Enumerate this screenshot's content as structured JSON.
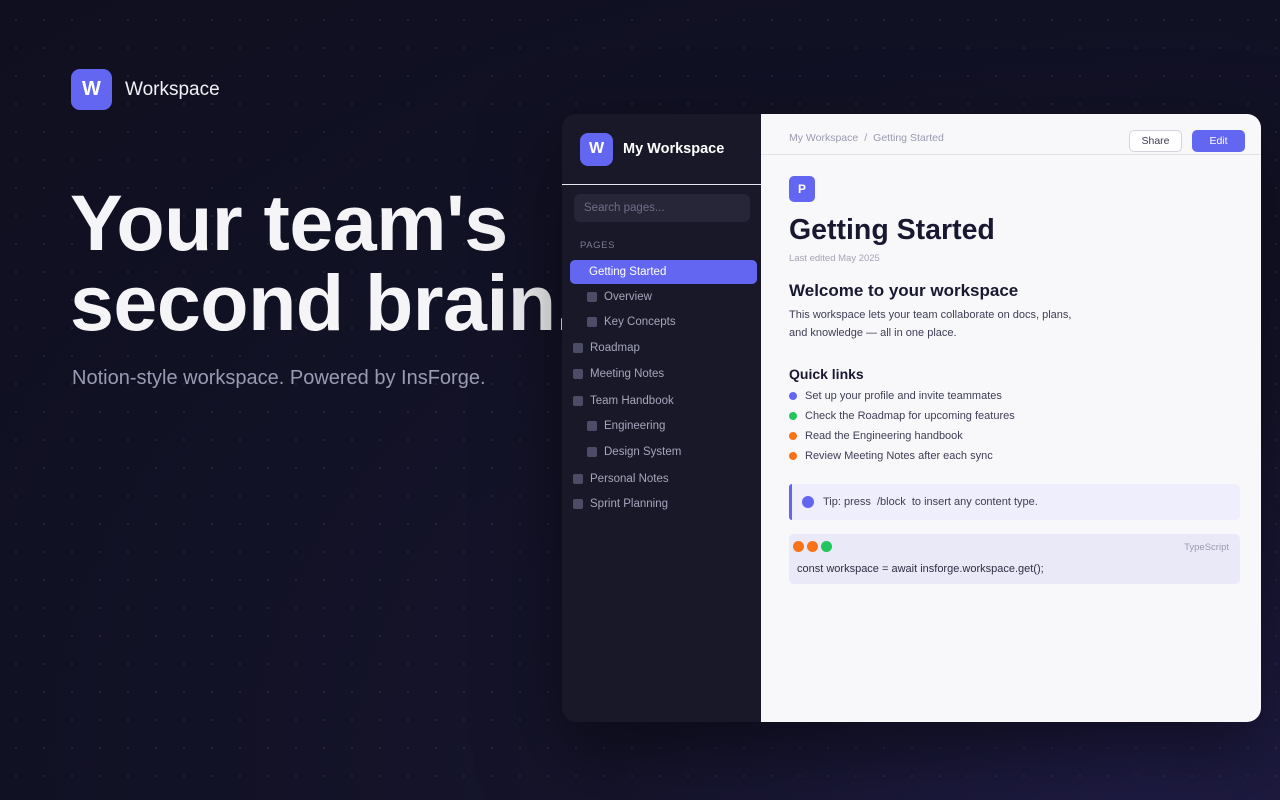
{
  "brand": {
    "logo_letter": "W",
    "name": "Workspace"
  },
  "hero": {
    "title_line1": "Your team's",
    "title_line2": "second brain.",
    "subtitle": "Notion-style workspace. Powered by InsForge."
  },
  "sidebar": {
    "logo_letter": "W",
    "title": "My Workspace",
    "search_placeholder": "Search pages...",
    "section_label": "PAGES",
    "items": [
      {
        "label": "Getting Started",
        "level": 0,
        "active": true
      },
      {
        "label": "Overview",
        "level": 1,
        "active": false
      },
      {
        "label": "Key Concepts",
        "level": 1,
        "active": false
      },
      {
        "label": "Roadmap",
        "level": 0,
        "active": false
      },
      {
        "label": "Meeting Notes",
        "level": 0,
        "active": false
      },
      {
        "label": "Team Handbook",
        "level": 0,
        "active": false
      },
      {
        "label": "Engineering",
        "level": 1,
        "active": false
      },
      {
        "label": "Design System",
        "level": 1,
        "active": false
      },
      {
        "label": "Personal Notes",
        "level": 0,
        "active": false
      },
      {
        "label": "Sprint Planning",
        "level": 0,
        "active": false
      }
    ]
  },
  "topbar": {
    "breadcrumb_root": "My Workspace",
    "breadcrumb_sep": "/",
    "breadcrumb_current": "Getting Started",
    "share_label": "Share",
    "edit_label": "Edit"
  },
  "page": {
    "icon_letter": "P",
    "title": "Getting Started",
    "meta": "Last edited May 2025",
    "welcome_heading": "Welcome to your workspace",
    "welcome_line1": "This workspace lets your team collaborate on docs, plans,",
    "welcome_line2": "and knowledge — all in one place.",
    "quick_links_heading": "Quick links",
    "quick_links": [
      {
        "text": "Set up your profile and invite teammates",
        "color": "#6366f1"
      },
      {
        "text": "Check the Roadmap for upcoming features",
        "color": "#22c55e"
      },
      {
        "text": "Read the Engineering handbook",
        "color": "#f97316"
      },
      {
        "text": "Review Meeting Notes after each sync",
        "color": "#f97316"
      }
    ],
    "tip": "Tip: press  /block  to insert any content type.",
    "code": {
      "language": "TypeScript",
      "line": "const workspace = await insforge.workspace.get();",
      "dot_colors": [
        "#f97316",
        "#f97316",
        "#22c55e"
      ]
    }
  },
  "colors": {
    "accent": "#6366f1",
    "sidebar_bg": "#181828",
    "page_bg": "#f8f8fb"
  }
}
